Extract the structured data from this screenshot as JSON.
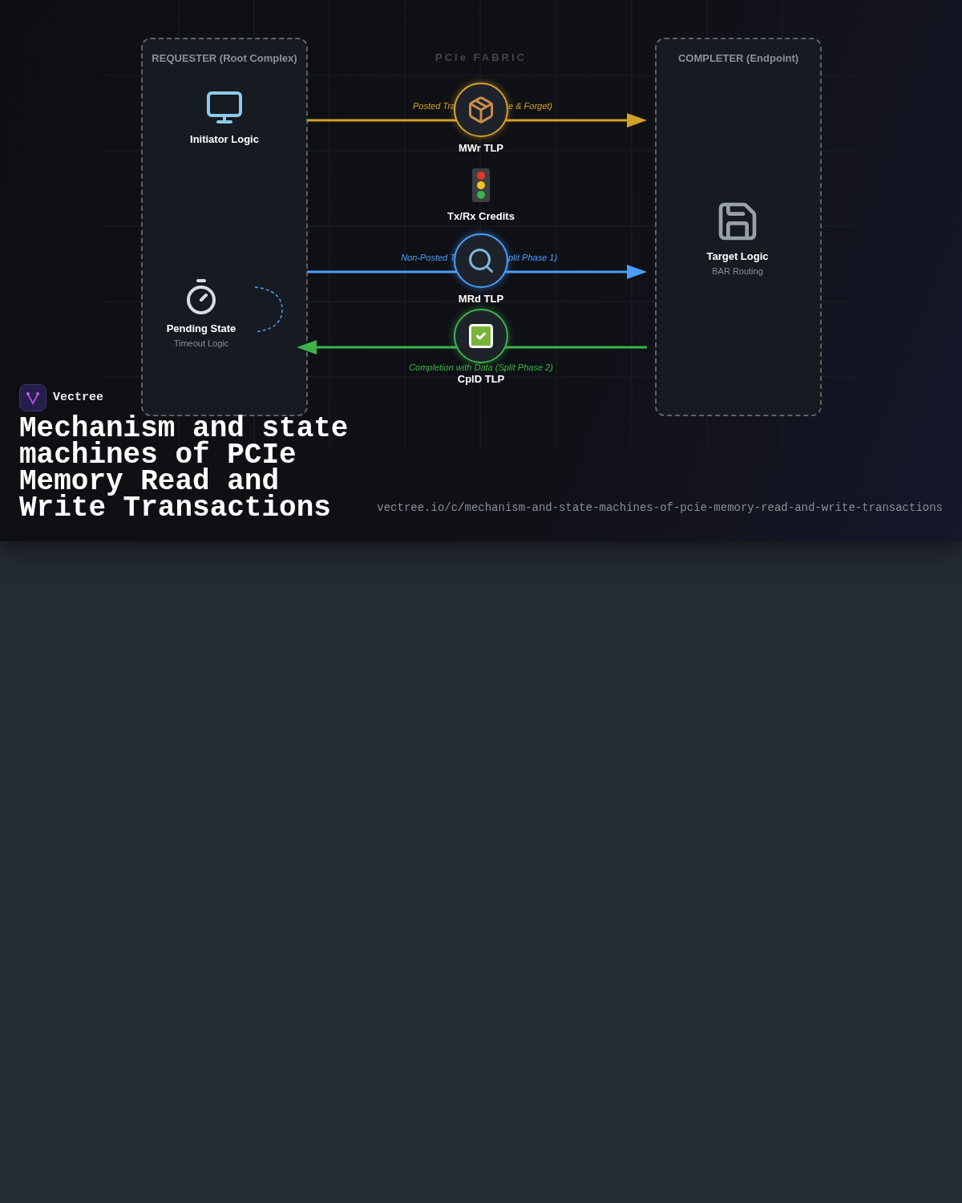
{
  "lanes": [
    {
      "kind": "box",
      "title": "REQUESTER (Root Complex)",
      "nodes": [
        {
          "kind": "monitor",
          "label": "Initiator Logic"
        },
        {
          "kind": "timer",
          "label": "Pending State",
          "sublabel": "Timeout Logic"
        }
      ]
    },
    {
      "kind": "header",
      "title": "PCIe FABRIC"
    },
    {
      "kind": "box",
      "title": "COMPLETER (Endpoint)",
      "nodes": [
        {
          "kind": "disk",
          "label": "Target Logic",
          "sublabel": "BAR Routing"
        }
      ]
    }
  ],
  "credits": {
    "label": "Tx/Rx Credits"
  },
  "transactions": [
    {
      "kind": "package",
      "label": "MWr TLP",
      "color": "#d4a02a",
      "points_left": false,
      "caption_parts": [
        "Posted Tra",
        "e & Forget)"
      ]
    },
    {
      "kind": "search",
      "label": "MRd TLP",
      "color": "#4a9eff",
      "points_left": false,
      "caption_parts": [
        "Non-Posted T",
        "plit Phase 1)"
      ]
    },
    {
      "kind": "check",
      "label": "CplD TLP",
      "color": "#3cb34a",
      "points_left": true,
      "caption_parts": [
        "Completion with Data (Split Phase 2)"
      ]
    }
  ],
  "brand": {
    "name": "Vectree"
  },
  "title": "Mechanism and state machines of PCIe Memory Read and Write Transactions",
  "url": "vectree.io/c/mechanism-and-state-machines-of-pcie-memory-read-and-write-transactions"
}
